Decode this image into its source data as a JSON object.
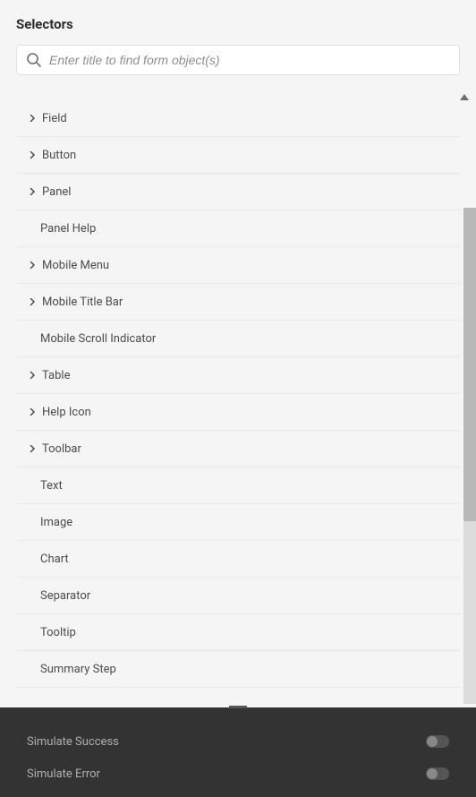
{
  "header": {
    "title": "Selectors"
  },
  "search": {
    "placeholder": "Enter title to find form object(s)"
  },
  "items": [
    {
      "label": "Field",
      "expandable": true
    },
    {
      "label": "Button",
      "expandable": true
    },
    {
      "label": "Panel",
      "expandable": true
    },
    {
      "label": "Panel Help",
      "expandable": false
    },
    {
      "label": "Mobile Menu",
      "expandable": true
    },
    {
      "label": "Mobile Title Bar",
      "expandable": true
    },
    {
      "label": "Mobile Scroll Indicator",
      "expandable": false
    },
    {
      "label": "Table",
      "expandable": true
    },
    {
      "label": "Help Icon",
      "expandable": true
    },
    {
      "label": "Toolbar",
      "expandable": true
    },
    {
      "label": "Text",
      "expandable": false
    },
    {
      "label": "Image",
      "expandable": false
    },
    {
      "label": "Chart",
      "expandable": false
    },
    {
      "label": "Separator",
      "expandable": false
    },
    {
      "label": "Tooltip",
      "expandable": false
    },
    {
      "label": "Summary Step",
      "expandable": false
    }
  ],
  "footer": {
    "simulate_success": "Simulate Success",
    "simulate_error": "Simulate Error"
  }
}
